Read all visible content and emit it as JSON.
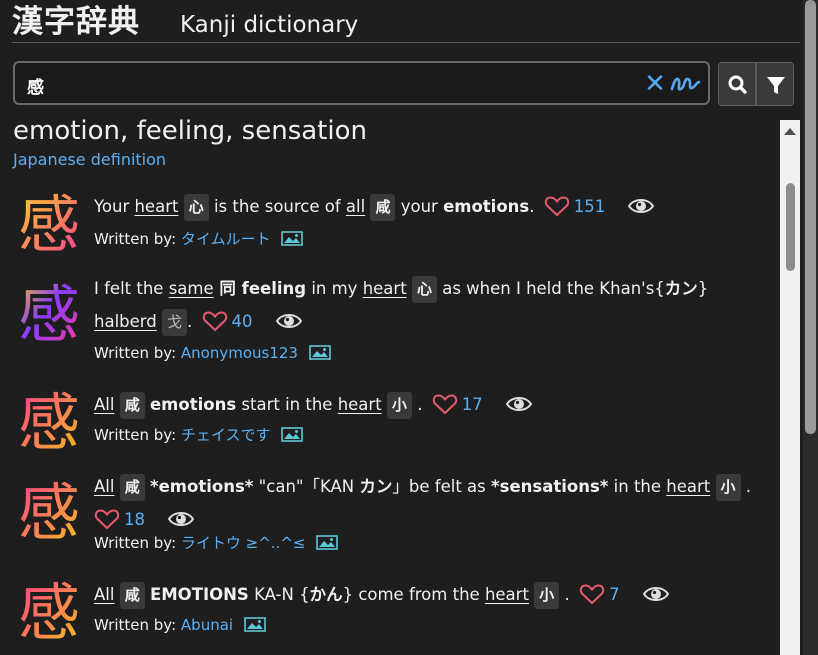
{
  "header": {
    "title": "漢字辞典",
    "subtitle": "Kanji dictionary"
  },
  "search": {
    "value": "感",
    "clear_glyph": "✕",
    "icons": [
      "search-icon",
      "filter-icon",
      "handwriting-icon",
      "close-icon"
    ]
  },
  "entry": {
    "meaning": "emotion, feeling, sensation",
    "japanese_definition_link": "Japanese definition"
  },
  "colors": {
    "background": "#1e1e1e",
    "link": "#5ab0f5",
    "heart": "#e8596e",
    "kanji_gradient_1": [
      "#f5d12a",
      "#ff3b8e"
    ],
    "kanji_gradient_2": [
      "#f5c21c",
      "#8a3bff",
      "#ff3b8e"
    ]
  },
  "stories": [
    {
      "kanji": "感",
      "likes": "151",
      "written_by_label": "Written by:",
      "author": "タイムルート"
    },
    {
      "kanji": "感",
      "likes": "40",
      "written_by_label": "Written by:",
      "author": "Anonymous123"
    },
    {
      "kanji": "感",
      "likes": "17",
      "written_by_label": "Written by:",
      "author": "チェイスです"
    },
    {
      "kanji": "感",
      "likes": "18",
      "written_by_label": "Written by:",
      "author": "ライトウ ≥^..^≤"
    },
    {
      "kanji": "感",
      "likes": "7",
      "written_by_label": "Written by:",
      "author": "Abunai"
    }
  ],
  "story_text": {
    "s1": [
      "Your ",
      "heart",
      "心",
      " is the source of ",
      "all",
      "咸",
      " your ",
      "emotions",
      "."
    ],
    "s2": [
      "I felt the ",
      "same",
      " 同 ",
      "feeling",
      " in my ",
      "heart",
      "心",
      " as when I held the Khan's{",
      "カン",
      "} ",
      "halberd",
      "戈",
      "."
    ],
    "s3": [
      "All",
      "咸",
      "emotions",
      " start in the ",
      "heart",
      "小",
      "."
    ],
    "s4": [
      "All",
      "咸",
      "*emotions*",
      " \"can\"「KAN ",
      "カン",
      "」be felt as ",
      "*sensations*",
      " in the ",
      "heart",
      "小",
      "."
    ],
    "s5": [
      "All",
      "咸",
      "EMOTIONS",
      " KA-N {",
      "かん",
      "} come from the ",
      "heart",
      "小",
      "."
    ]
  }
}
